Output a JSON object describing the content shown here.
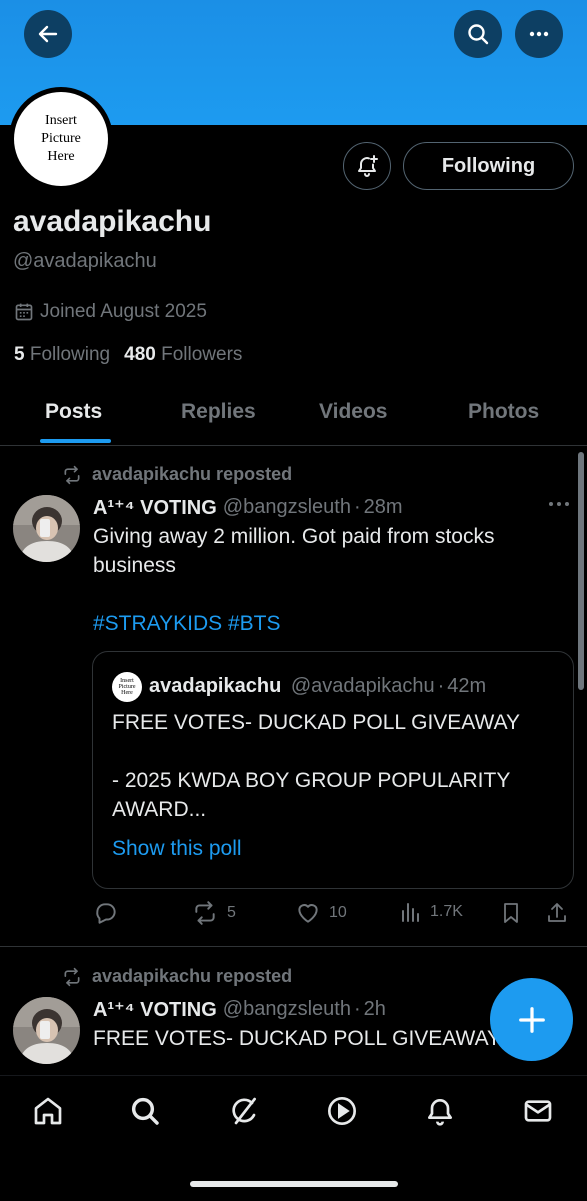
{
  "profile": {
    "avatar_text": "Insert Picture Here",
    "name": "avadapikachu",
    "handle": "@avadapikachu",
    "joined": "Joined August 2025",
    "following_count": "5",
    "following_label": "Following",
    "followers_count": "480",
    "followers_label": "Followers",
    "following_button": "Following"
  },
  "tabs": [
    "Posts",
    "Replies",
    "Videos",
    "Photos"
  ],
  "posts": [
    {
      "repost_label": "avadapikachu reposted",
      "author_name": "A¹⁺⁴ VOTING",
      "author_handle": "@bangzsleuth",
      "time": "28m",
      "text": "Giving away 2 million. Got paid from stocks business",
      "hashtags": "#STRAYKIDS #BTS",
      "quote": {
        "avatar_text": "Insert Picture Here",
        "name": "avadapikachu",
        "handle": "@avadapikachu",
        "time": "42m",
        "line1": "FREE VOTES- DUCKAD POLL GIVEAWAY",
        "line2": "- 2025 KWDA BOY GROUP POPULARITY AWARD...",
        "show_poll": "Show this poll"
      },
      "actions": {
        "reposts": "5",
        "likes": "10",
        "views": "1.7K"
      }
    },
    {
      "repost_label": "avadapikachu reposted",
      "author_name": "A¹⁺⁴ VOTING",
      "author_handle": "@bangzsleuth",
      "time": "2h",
      "text": "FREE VOTES- DUCKAD POLL GIVEAWAY"
    }
  ],
  "meta_sep": "·",
  "icons": [
    "back-arrow-icon",
    "search-icon",
    "more-icon",
    "bell-plus-icon",
    "calendar-icon",
    "repost-icon",
    "reply-icon",
    "like-icon",
    "views-icon",
    "bookmark-icon",
    "share-icon",
    "plus-icon",
    "home-icon",
    "grok-icon",
    "play-icon",
    "notifications-icon",
    "messages-icon"
  ],
  "colors": {
    "accent": "#1d9bf0",
    "text": "#e7e9ea",
    "muted": "#71767b",
    "border": "#2f3336"
  }
}
